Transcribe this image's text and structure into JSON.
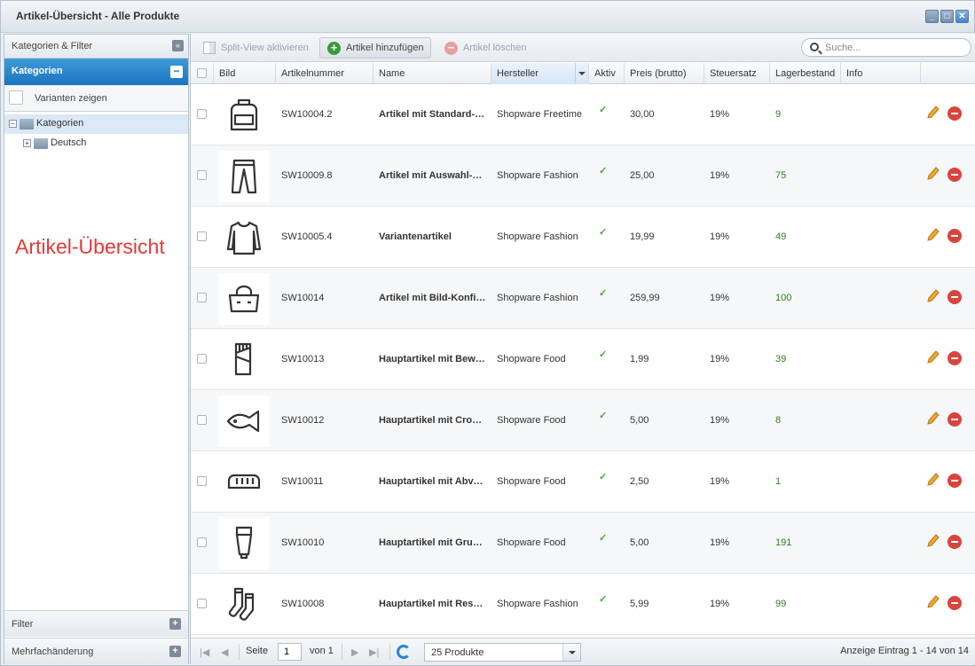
{
  "window": {
    "title": "Artikel-Übersicht - Alle Produkte"
  },
  "left": {
    "header": "Kategorien & Filter",
    "categories_title": "Kategorien",
    "variants_label": "Varianten zeigen",
    "tree": [
      {
        "label": "Kategorien",
        "expanded": true
      },
      {
        "label": "Deutsch",
        "expanded": false
      }
    ],
    "overlay_text": "Artikel-Übersicht",
    "filter_label": "Filter",
    "mass_edit_label": "Mehrfachänderung"
  },
  "toolbar": {
    "split_view": "Split-View aktivieren",
    "add_article": "Artikel hinzufügen",
    "delete_article": "Artikel löschen",
    "search_placeholder": "Suche..."
  },
  "grid": {
    "columns": [
      "Bild",
      "Artikelnummer",
      "Name",
      "Hersteller",
      "Aktiv",
      "Preis (brutto)",
      "Steuersatz",
      "Lagerbestand",
      "Info"
    ],
    "rows": [
      {
        "icon": "backpack-icon",
        "number": "SW10004.2",
        "name": "Artikel mit Standard-…",
        "manufacturer": "Shopware Freetime",
        "active": "✓",
        "price": "30,00",
        "tax": "19%",
        "stock": "9"
      },
      {
        "icon": "trousers-icon",
        "number": "SW10009.8",
        "name": "Artikel mit Auswahl-…",
        "manufacturer": "Shopware Fashion",
        "active": "✓",
        "price": "25,00",
        "tax": "19%",
        "stock": "75"
      },
      {
        "icon": "sweater-icon",
        "number": "SW10005.4",
        "name": "Variantenartikel",
        "manufacturer": "Shopware Fashion",
        "active": "✓",
        "price": "19,99",
        "tax": "19%",
        "stock": "49"
      },
      {
        "icon": "bag-icon",
        "number": "SW10014",
        "name": "Artikel mit Bild-Konfi…",
        "manufacturer": "Shopware Fashion",
        "active": "✓",
        "price": "259,99",
        "tax": "19%",
        "stock": "100"
      },
      {
        "icon": "chocolate-icon",
        "number": "SW10013",
        "name": "Hauptartikel mit Bew…",
        "manufacturer": "Shopware Food",
        "active": "✓",
        "price": "1,99",
        "tax": "19%",
        "stock": "39"
      },
      {
        "icon": "fish-icon",
        "number": "SW10012",
        "name": "Hauptartikel mit Cro…",
        "manufacturer": "Shopware Food",
        "active": "✓",
        "price": "5,00",
        "tax": "19%",
        "stock": "8"
      },
      {
        "icon": "bread-icon",
        "number": "SW10011",
        "name": "Hauptartikel mit Abv…",
        "manufacturer": "Shopware Food",
        "active": "✓",
        "price": "2,50",
        "tax": "19%",
        "stock": "1"
      },
      {
        "icon": "tube-icon",
        "number": "SW10010",
        "name": "Hauptartikel mit Gru…",
        "manufacturer": "Shopware Food",
        "active": "✓",
        "price": "5,00",
        "tax": "19%",
        "stock": "191"
      },
      {
        "icon": "socks-icon",
        "number": "SW10008",
        "name": "Hauptartikel mit Res…",
        "manufacturer": "Shopware Fashion",
        "active": "✓",
        "price": "5,99",
        "tax": "19%",
        "stock": "99"
      }
    ]
  },
  "pager": {
    "page_label": "Seite",
    "page_value": "1",
    "of_label": "von 1",
    "per_page": "25 Produkte",
    "display_info": "Anzeige Eintrag 1 - 14 von 14"
  },
  "colors": {
    "accent": "#1b74c0",
    "overlay": "#e53935",
    "stock_green": "#2e7d1f",
    "delete_red": "#d9443c"
  }
}
